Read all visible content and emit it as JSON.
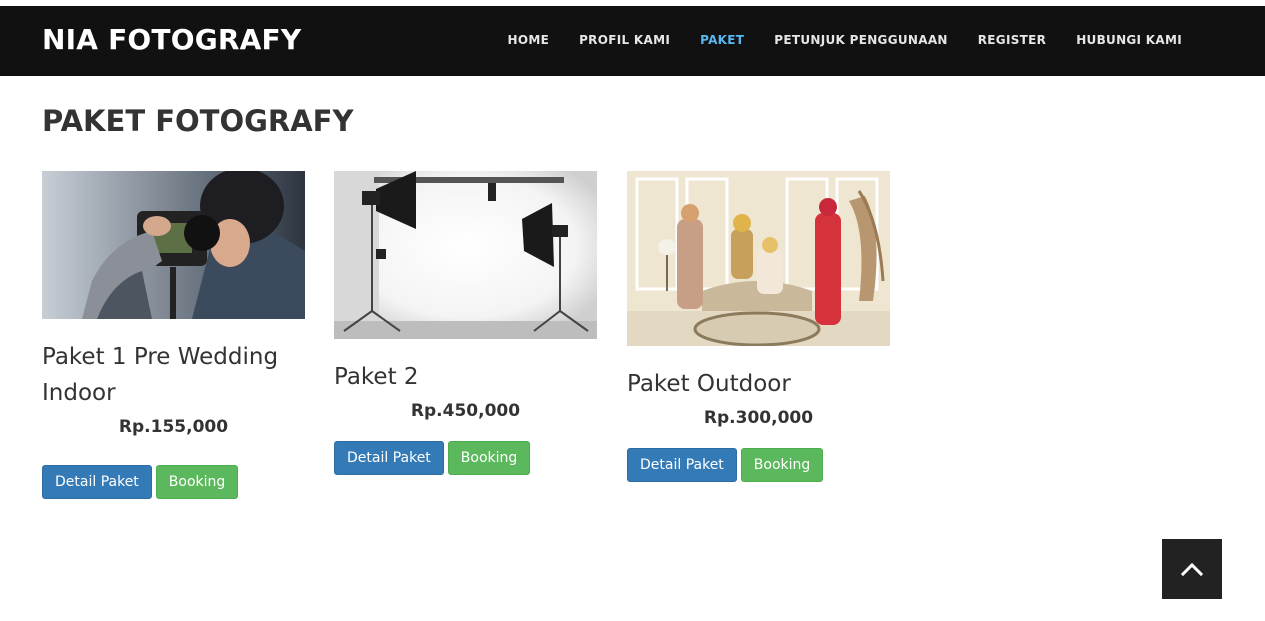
{
  "brand": "NIA FOTOGRAFY",
  "nav": [
    {
      "label": "HOME",
      "active": false
    },
    {
      "label": "PROFIL KAMI",
      "active": false
    },
    {
      "label": "PAKET",
      "active": true
    },
    {
      "label": "PETUNJUK PENGGUNAAN",
      "active": false
    },
    {
      "label": "REGISTER",
      "active": false
    },
    {
      "label": "HUBUNGI KAMI",
      "active": false
    }
  ],
  "page_title": "PAKET FOTOGRAFY",
  "packages": [
    {
      "name_line1": "Paket 1 Pre Wedding",
      "name_line2": "Indoor",
      "price": "Rp.155,000",
      "detail_label": "Detail Paket",
      "booking_label": "Booking"
    },
    {
      "name_line1": "Paket 2",
      "name_line2": "",
      "price": "Rp.450,000",
      "detail_label": "Detail Paket",
      "booking_label": "Booking"
    },
    {
      "name_line1": "Paket Outdoor",
      "name_line2": "",
      "price": "Rp.300,000",
      "detail_label": "Detail Paket",
      "booking_label": "Booking"
    }
  ],
  "colors": {
    "navbar": "#111111",
    "active_nav": "#58b8f0",
    "detail_button": "#337ab7",
    "booking_button": "#5cb85c"
  },
  "icons": {
    "back_to_top": "chevron-up-icon"
  }
}
